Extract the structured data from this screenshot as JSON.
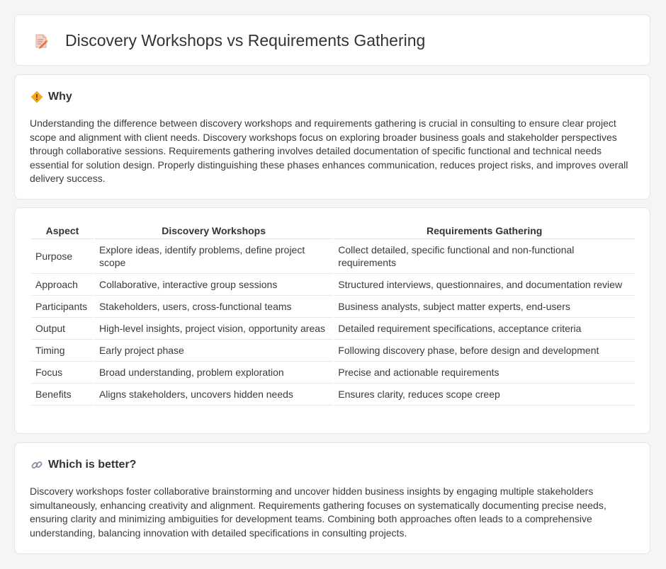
{
  "header": {
    "title": "Discovery Workshops vs Requirements Gathering",
    "icon": "document-pencil-icon"
  },
  "why": {
    "heading": "Why",
    "icon": "diamond-warning-icon",
    "text": "Understanding the difference between discovery workshops and requirements gathering is crucial in consulting to ensure clear project scope and alignment with client needs. Discovery workshops focus on exploring broader business goals and stakeholder perspectives through collaborative sessions. Requirements gathering involves detailed documentation of specific functional and technical needs essential for solution design. Properly distinguishing these phases enhances communication, reduces project risks, and improves overall delivery success."
  },
  "table": {
    "headers": [
      "Aspect",
      "Discovery Workshops",
      "Requirements Gathering"
    ],
    "rows": [
      [
        "Purpose",
        "Explore ideas, identify problems, define project scope",
        "Collect detailed, specific functional and non-functional requirements"
      ],
      [
        "Approach",
        "Collaborative, interactive group sessions",
        "Structured interviews, questionnaires, and documentation review"
      ],
      [
        "Participants",
        "Stakeholders, users, cross-functional teams",
        "Business analysts, subject matter experts, end-users"
      ],
      [
        "Output",
        "High-level insights, project vision, opportunity areas",
        "Detailed requirement specifications, acceptance criteria"
      ],
      [
        "Timing",
        "Early project phase",
        "Following discovery phase, before design and development"
      ],
      [
        "Focus",
        "Broad understanding, problem exploration",
        "Precise and actionable requirements"
      ],
      [
        "Benefits",
        "Aligns stakeholders, uncovers hidden needs",
        "Ensures clarity, reduces scope creep"
      ]
    ]
  },
  "better": {
    "heading": "Which is better?",
    "icon": "link-icon",
    "text": "Discovery workshops foster collaborative brainstorming and uncover hidden business insights by engaging multiple stakeholders simultaneously, enhancing creativity and alignment. Requirements gathering focuses on systematically documenting precise needs, ensuring clarity and minimizing ambiguities for development teams. Combining both approaches often leads to a comprehensive understanding, balancing innovation with detailed specifications in consulting projects."
  }
}
